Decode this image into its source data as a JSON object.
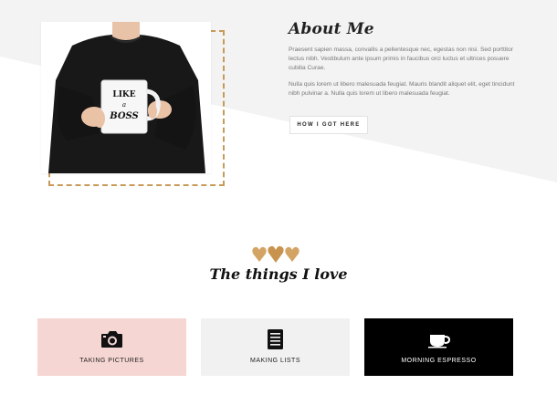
{
  "about": {
    "title": "About Me",
    "paragraph_1": "Praesent sapien massa, convallis a pellentesque nec, egestas non nisi. Sed porttitor lectus nibh. Vestibulum ante ipsum primis in faucibus orci luctus et ultrices posuere cubilia Curae.",
    "paragraph_2": "Nulla quis lorem ut libero malesuada feugiat. Mauris blandit aliquet elit, eget tincidunt nibh pulvinar a. Nulla quis lorem ut libero malesuada feugiat.",
    "button_label": "HOW I GOT HERE",
    "mug_text_line1": "LIKE",
    "mug_text_line2": "a",
    "mug_text_line3": "BOSS"
  },
  "things": {
    "title": "The things I love",
    "cards": [
      {
        "label": "TAKING PICTURES",
        "icon": "camera-icon",
        "bg": "#f6d6d3"
      },
      {
        "label": "MAKING LISTS",
        "icon": "list-icon",
        "bg": "#f1f1f1"
      },
      {
        "label": "MORNING ESPRESSO",
        "icon": "coffee-cup-icon",
        "bg": "#000000"
      }
    ]
  },
  "colors": {
    "accent_gold": "#c79a5a",
    "hero_background": "#f3f3f3",
    "pink": "#f6d6d3"
  }
}
